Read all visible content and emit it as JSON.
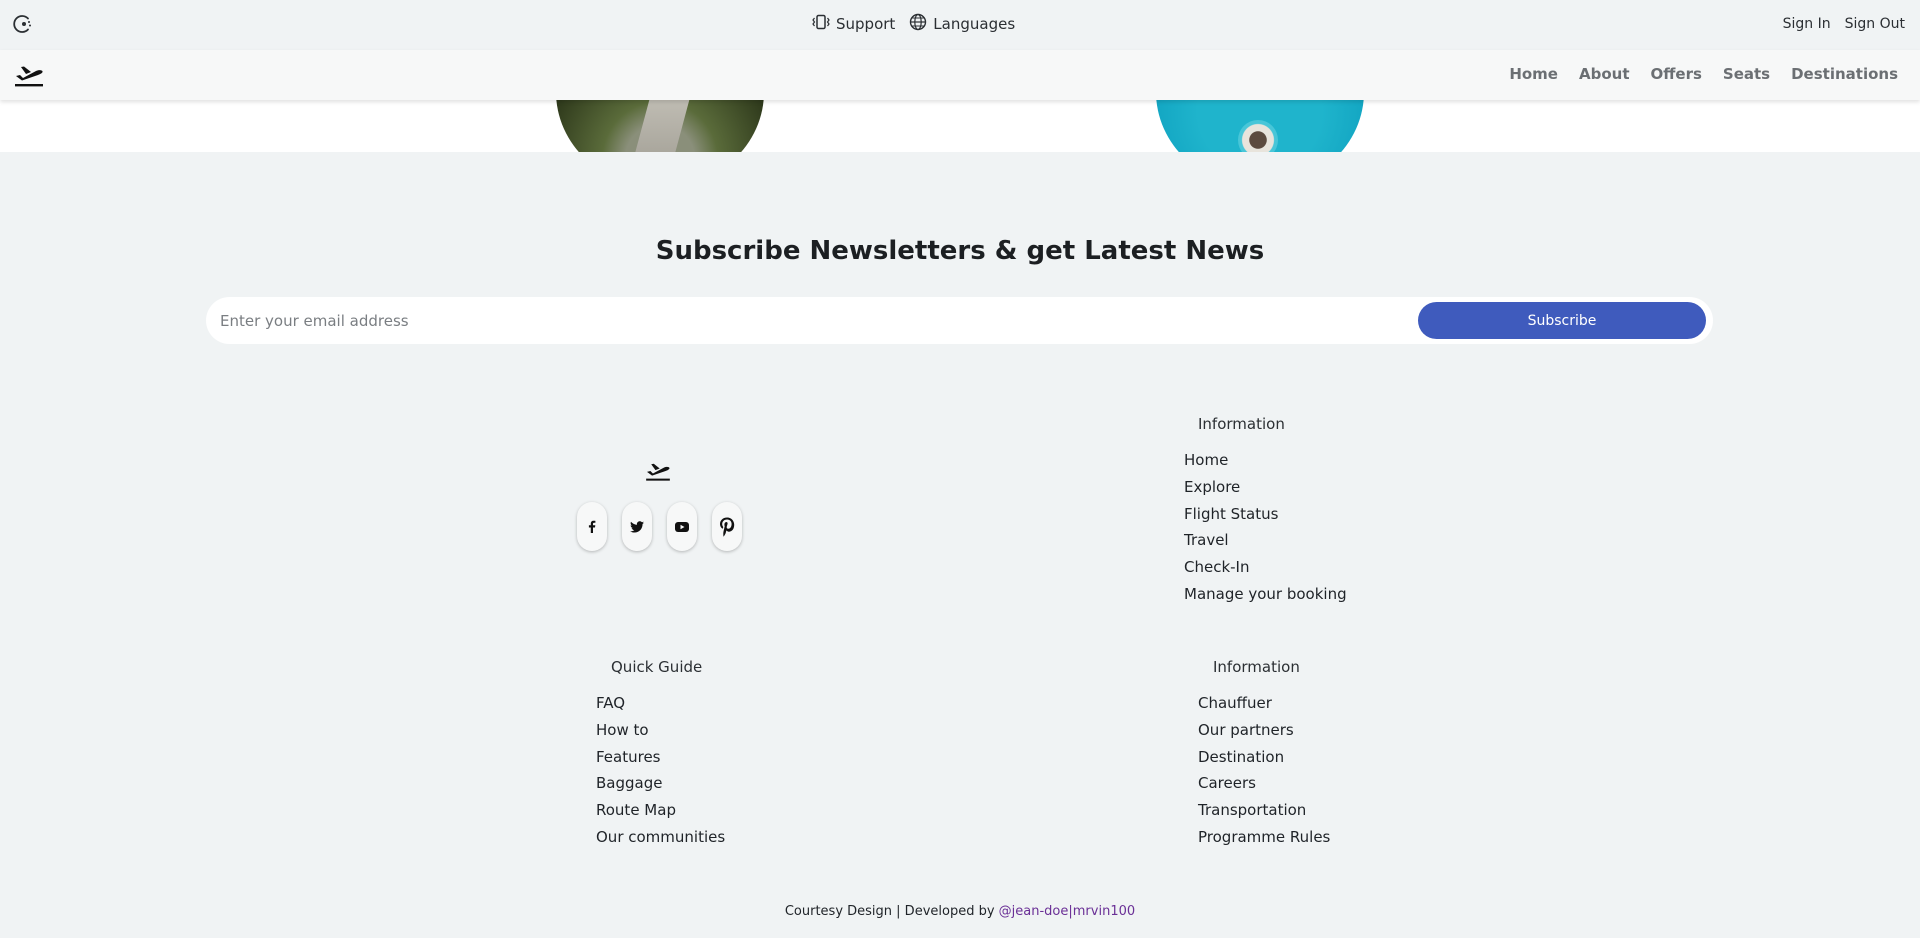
{
  "topbar": {
    "mode_icon": "theme-toggle-icon",
    "support_label": "Support",
    "languages_label": "Languages",
    "sign_in": "Sign In",
    "sign_out": "Sign Out"
  },
  "navbar": {
    "logo_icon": "plane-departure-icon",
    "links": [
      "Home",
      "About",
      "Offers",
      "Seats",
      "Destinations"
    ]
  },
  "newsletter": {
    "title": "Subscribe Newsletters & get Latest News",
    "email_placeholder": "Enter your email address",
    "subscribe_label": "Subscribe",
    "accent_color": "#3f5bbd"
  },
  "footer": {
    "socials": [
      "facebook-icon",
      "twitter-icon",
      "youtube-icon",
      "pinterest-icon"
    ],
    "info_primary": {
      "heading": "Information",
      "items": [
        "Home",
        "Explore",
        "Flight Status",
        "Travel",
        "Check-In",
        "Manage your booking"
      ]
    },
    "quick_guide": {
      "heading": "Quick Guide",
      "items": [
        "FAQ",
        "How to",
        "Features",
        "Baggage",
        "Route Map",
        "Our communities"
      ]
    },
    "info_secondary": {
      "heading": "Information",
      "items": [
        "Chauffuer",
        "Our partners",
        "Destination",
        "Careers",
        "Transportation",
        "Programme Rules"
      ]
    },
    "credit_text": "Courtesy Design | Developed by ",
    "credit_link": "@jean-doe|mrvin100"
  }
}
